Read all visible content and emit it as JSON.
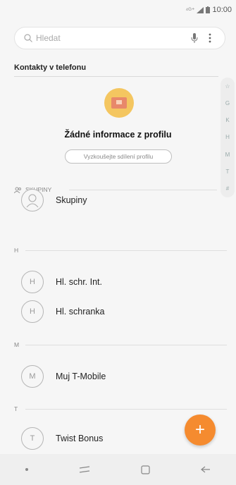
{
  "status_bar": {
    "signal": "⁴ᴳ⁺",
    "time": "10:00"
  },
  "search": {
    "placeholder": "Hledat"
  },
  "section": {
    "title": "Kontakty v telefonu"
  },
  "index_letters": [
    "☆",
    "G",
    "K",
    "H",
    "M",
    "T",
    "#"
  ],
  "profile": {
    "empty_text": "Žádné informace z profilu",
    "button_label": "Vyzkoušejte sdílení profilu"
  },
  "groups": {
    "header": "SKUPINY",
    "item": "Skupiny"
  },
  "letters": {
    "h": "H",
    "m": "M",
    "t": "T"
  },
  "contacts": [
    {
      "initial": "H",
      "name": "Hl. schr. Int."
    },
    {
      "initial": "H",
      "name": "Hl. schranka"
    },
    {
      "initial": "M",
      "name": "Muj T-Mobile"
    },
    {
      "initial": "T",
      "name": "Twist Bonus"
    }
  ],
  "fab": {
    "label": "+"
  },
  "colors": {
    "accent": "#f58b2f",
    "background": "#f6f6f6"
  },
  "icons": {
    "search": "search-icon",
    "mic": "mic-icon",
    "more": "more-vert-icon",
    "groups": "group-icon"
  }
}
